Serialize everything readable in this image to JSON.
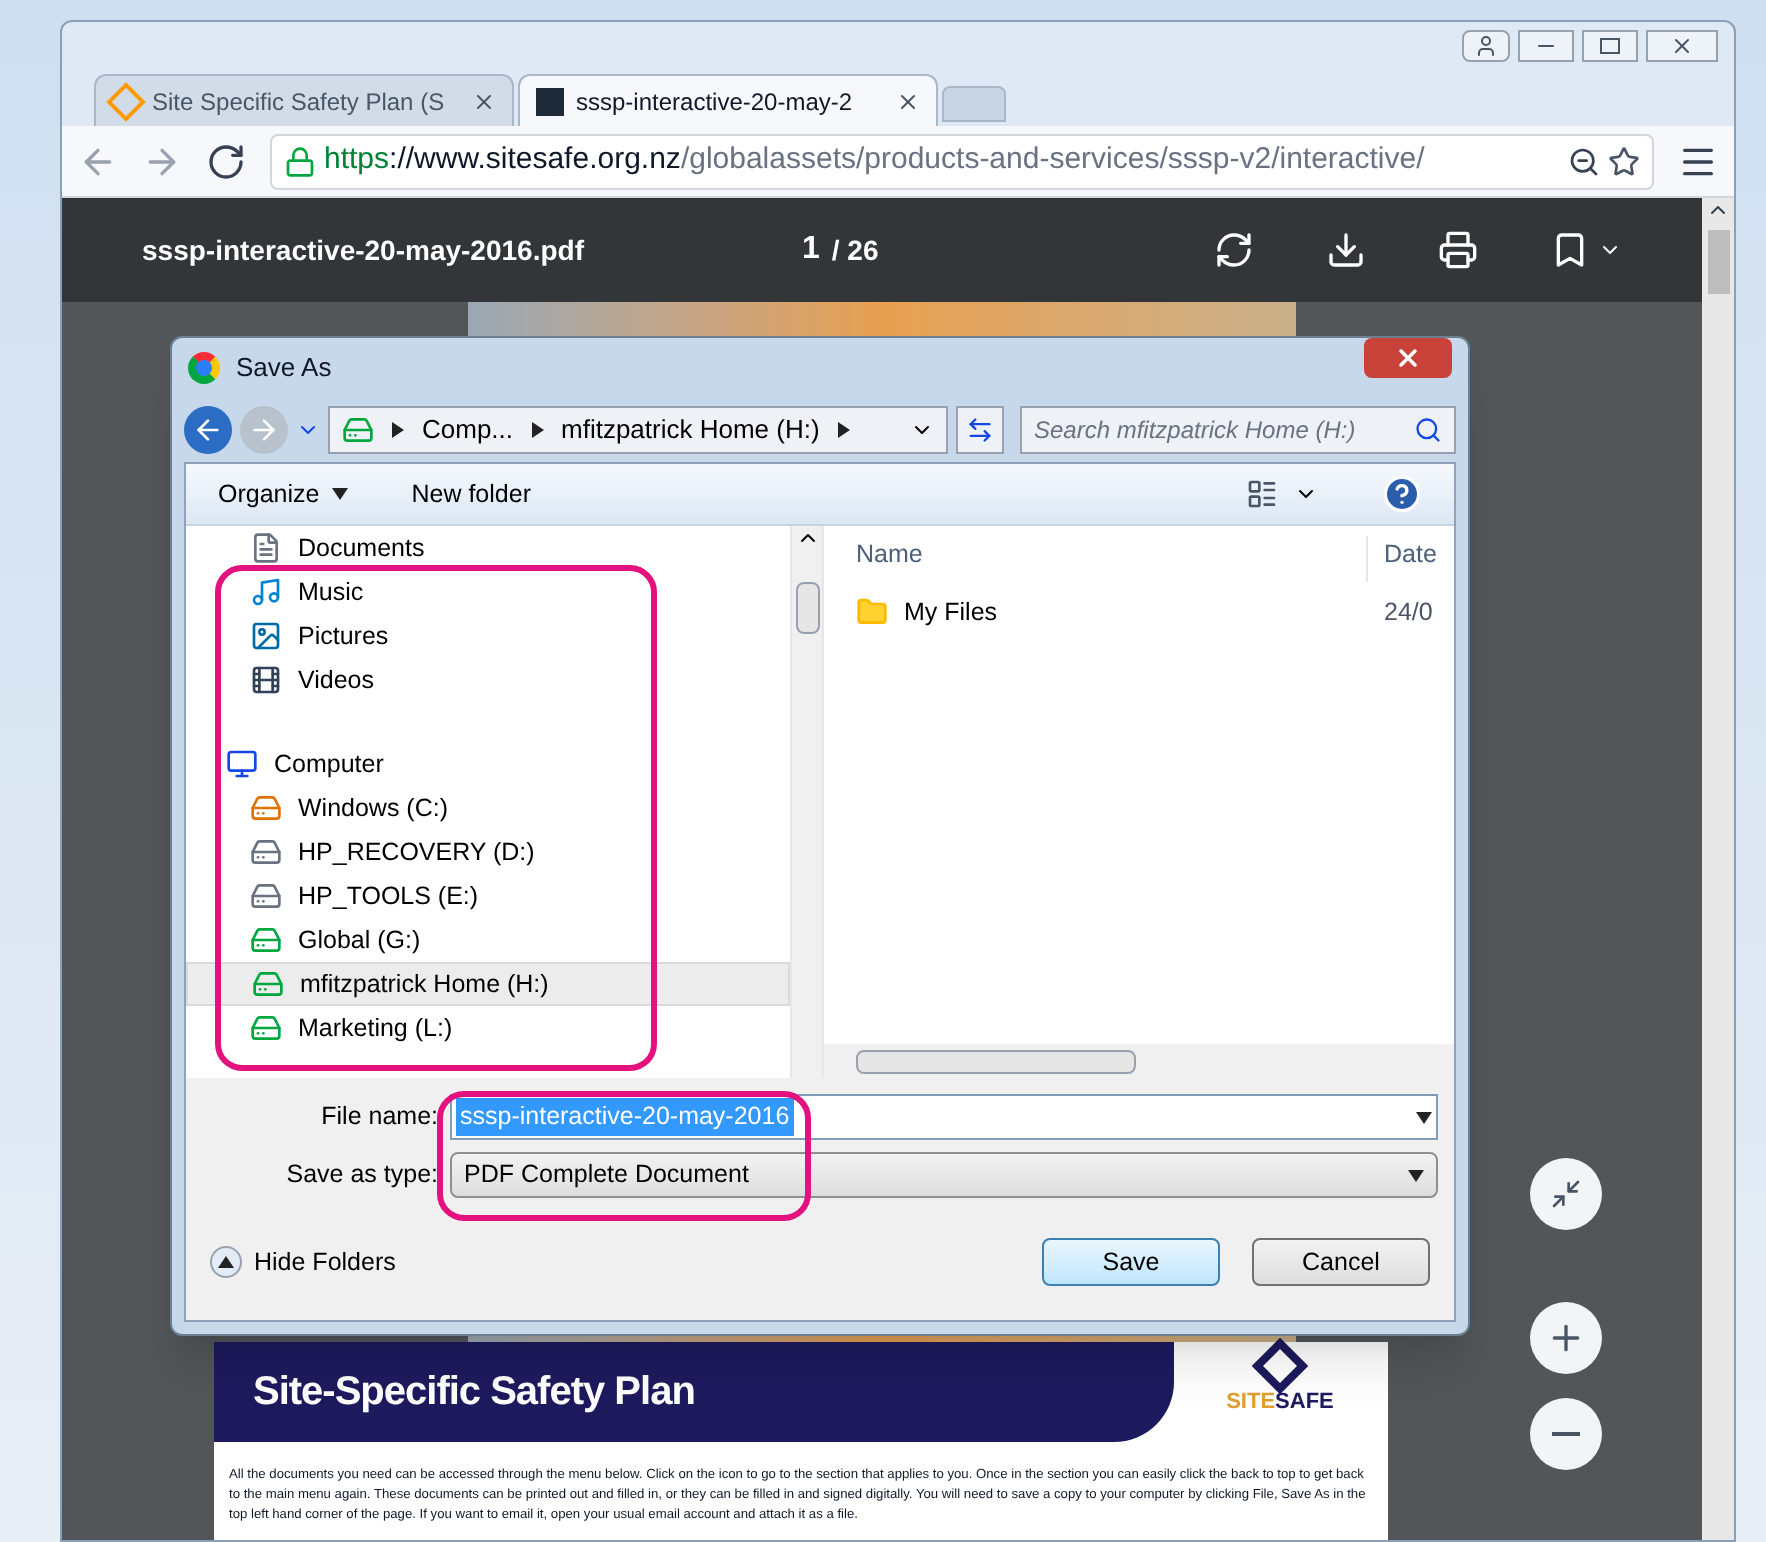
{
  "browser": {
    "tabs": [
      {
        "title": "Site Specific Safety Plan (S",
        "selected": false
      },
      {
        "title": "sssp-interactive-20-may-2",
        "selected": true
      }
    ],
    "url": {
      "scheme": "https",
      "host": "://www.sitesafe.org.nz",
      "path": "/globalassets/products-and-services/sssp-v2/interactive/"
    }
  },
  "pdf_viewer": {
    "file_name": "sssp-interactive-20-may-2016.pdf",
    "page": "1",
    "page_total": "/ 26",
    "document": {
      "title": "Site-Specific Safety Plan",
      "logo_first": "SITE",
      "logo_second": "SAFE",
      "body": "All the documents you need can be accessed through the menu below. Click on the icon to go to the section that applies to you. Once in the section you can easily click the back to top to get back to the main menu again. These documents can be printed out and filled in, or they can be filled in and signed digitally.  You will need to save a copy to your computer by clicking File, Save As in the top left hand corner of the page.  If you want to email it, open your usual email account and attach it as a file."
    }
  },
  "dialog": {
    "title": "Save As",
    "breadcrumb": [
      "Comp...",
      "mfitzpatrick Home (H:)"
    ],
    "search_placeholder": "Search mfitzpatrick Home (H:)",
    "toolbar": [
      "Organize",
      "New folder"
    ],
    "nav_items": [
      {
        "label": "Documents",
        "kind": "documents",
        "selected": false
      },
      {
        "label": "Music",
        "kind": "music",
        "selected": false
      },
      {
        "label": "Pictures",
        "kind": "pictures",
        "selected": false
      },
      {
        "label": "Videos",
        "kind": "videos",
        "selected": false
      },
      {
        "label": "Computer",
        "kind": "computer",
        "selected": false
      },
      {
        "label": "Windows (C:)",
        "kind": "system-drive",
        "selected": false
      },
      {
        "label": "HP_RECOVERY (D:)",
        "kind": "drive",
        "selected": false
      },
      {
        "label": "HP_TOOLS (E:)",
        "kind": "drive",
        "selected": false
      },
      {
        "label": "Global (G:)",
        "kind": "network-drive",
        "selected": false
      },
      {
        "label": "mfitzpatrick Home (H:)",
        "kind": "network-drive",
        "selected": true
      },
      {
        "label": "Marketing (L:)",
        "kind": "network-drive",
        "selected": false
      }
    ],
    "columns": [
      "Name",
      "Date"
    ],
    "files": [
      {
        "name": "My Files",
        "date": "24/0"
      }
    ],
    "file_name_label": "File name:",
    "file_name": "sssp-interactive-20-may-2016",
    "type_label": "Save as type:",
    "type": "PDF Complete Document",
    "hide_folders": "Hide Folders",
    "buttons": [
      {
        "label": "Save",
        "default": true
      },
      {
        "label": "Cancel",
        "default": false
      }
    ]
  }
}
